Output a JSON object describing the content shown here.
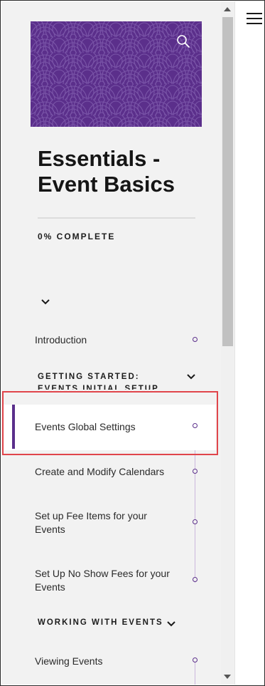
{
  "course": {
    "title_line1": "Essentials -",
    "title_line2": "Event Basics",
    "progress": "0% COMPLETE"
  },
  "lessons": [
    {
      "label": "Introduction"
    },
    {
      "label": "Events Global Settings"
    },
    {
      "label": "Create and Modify Calendars"
    },
    {
      "label": "Set up Fee Items for your Events"
    },
    {
      "label": "Set Up No Show Fees for your Events"
    },
    {
      "label": "Viewing Events"
    }
  ],
  "sections": [
    {
      "label": "GETTING STARTED: EVENTS INITIAL SETUP"
    },
    {
      "label": "WORKING WITH EVENTS"
    }
  ],
  "icons": {
    "search": "search-icon",
    "menu": "hamburger-menu-icon",
    "chevron": "chevron-down-icon"
  },
  "colors": {
    "brand_purple": "#5b2f8b",
    "highlight_red": "#e0454b",
    "sidebar_bg": "#f2f2f2"
  }
}
